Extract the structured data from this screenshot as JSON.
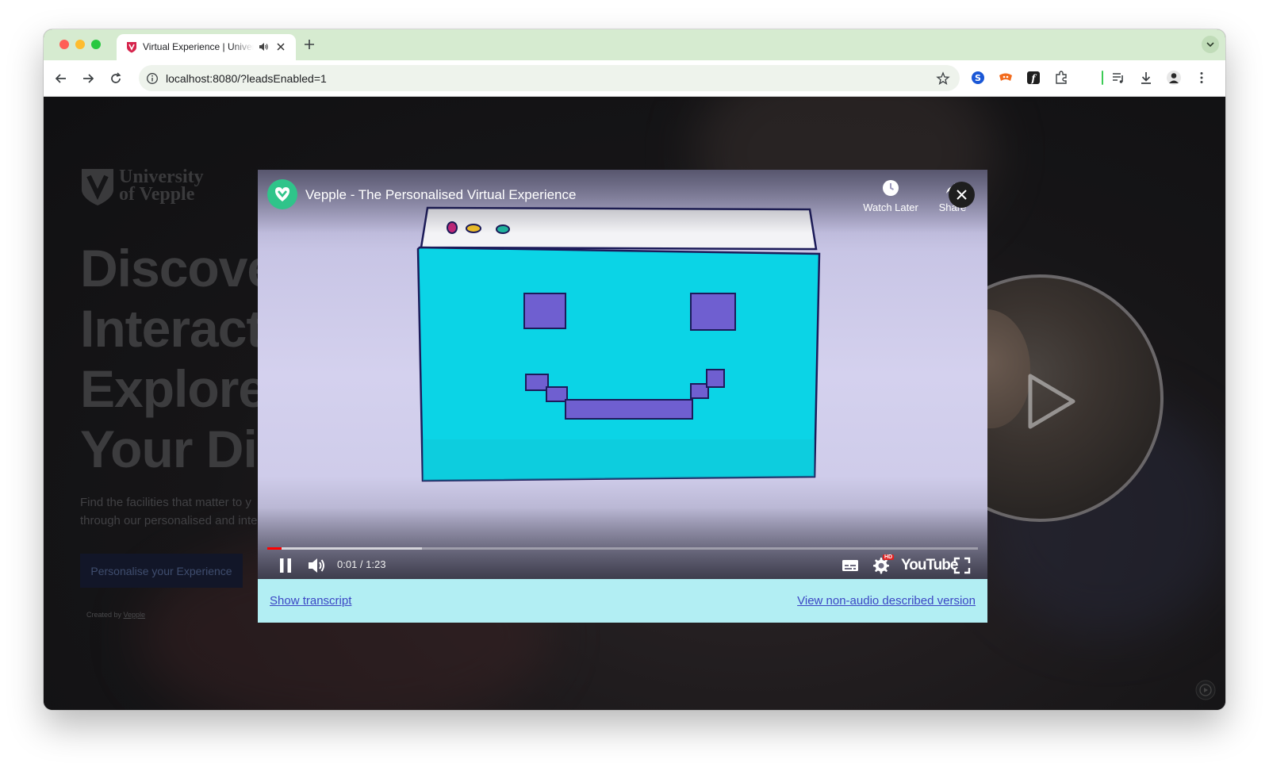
{
  "browser": {
    "tab_title": "Virtual Experience | University of Vepple",
    "url": "localhost:8080/?leadsEnabled=1"
  },
  "page": {
    "logo_text_line1": "University",
    "logo_text_line2": "of Vepple",
    "hero_lines": [
      "Discove",
      "Interact",
      "Explore",
      "Your Dig"
    ],
    "hero_sub_line1": "Find the facilities that matter to y",
    "hero_sub_line2": "through our personalised and inte",
    "cta_label": "Personalise your Experience",
    "created_by_prefix": "Created by ",
    "created_by_link": "Vepple"
  },
  "video": {
    "title": "Vepple - The Personalised Virtual Experience",
    "watch_later_label": "Watch Later",
    "share_label": "Share",
    "time_display": "0:01 / 1:23",
    "played_fraction": 0.02,
    "buffered_fraction": 0.218,
    "youtube_label": "YouTube",
    "hd_badge": "HD"
  },
  "modal": {
    "transcript_link": "Show transcript",
    "non_audio_link": "View non-audio described version"
  },
  "colors": {
    "tabstrip": "#d6ebd0",
    "transcript_bar": "#b2eef3",
    "link": "#3b46c4",
    "drawing_fill": "#0bd4e6",
    "drawing_features": "#6f5fd0",
    "progress_played": "#ff0000"
  },
  "icons": {
    "tab_favicon": "vepple-shield-icon",
    "tab_audio": "speaker-icon",
    "close_modal": "close-icon",
    "watch_later": "clock-icon",
    "share": "share-arrow-icon",
    "play_pause": "pause-icon",
    "volume": "volume-icon",
    "captions": "subtitles-icon",
    "settings": "gear-icon",
    "fullscreen": "fullscreen-icon"
  }
}
